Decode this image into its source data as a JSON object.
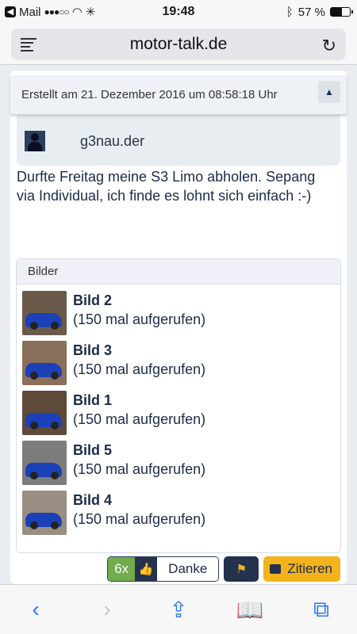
{
  "status": {
    "carrier": "Mail",
    "signal": "●●●○○",
    "time": "19:48",
    "battery": "57 %"
  },
  "browser": {
    "url": "motor-talk.de"
  },
  "post": {
    "created": "Erstellt am 21. Dezember 2016 um 08:58:18 Uhr",
    "collapse_icon": "▲",
    "username": "g3nau.der",
    "text": "Durfte Freitag meine S3 Limo abholen. Sepang via Individual, ich finde es lohnt sich einfach :-)",
    "images_header": "Bilder",
    "images": [
      {
        "title": "Bild 2",
        "views": "(150 mal aufgerufen)",
        "bg": "#6b5a4a"
      },
      {
        "title": "Bild 3",
        "views": "(150 mal aufgerufen)",
        "bg": "#8a6f5a"
      },
      {
        "title": "Bild 1",
        "views": "(150 mal aufgerufen)",
        "bg": "#5e4a3a"
      },
      {
        "title": "Bild 5",
        "views": "(150 mal aufgerufen)",
        "bg": "#7c7c7c"
      },
      {
        "title": "Bild 4",
        "views": "(150 mal aufgerufen)",
        "bg": "#9a8e82"
      }
    ]
  },
  "actions": {
    "danke_count": "6x",
    "danke_label": "Danke",
    "zitieren_label": "Zitieren"
  },
  "colors": {
    "accent": "#2b79f6",
    "danke_green": "#71ac4e",
    "zitieren_yellow": "#f2b31d",
    "navy": "#25324d"
  }
}
